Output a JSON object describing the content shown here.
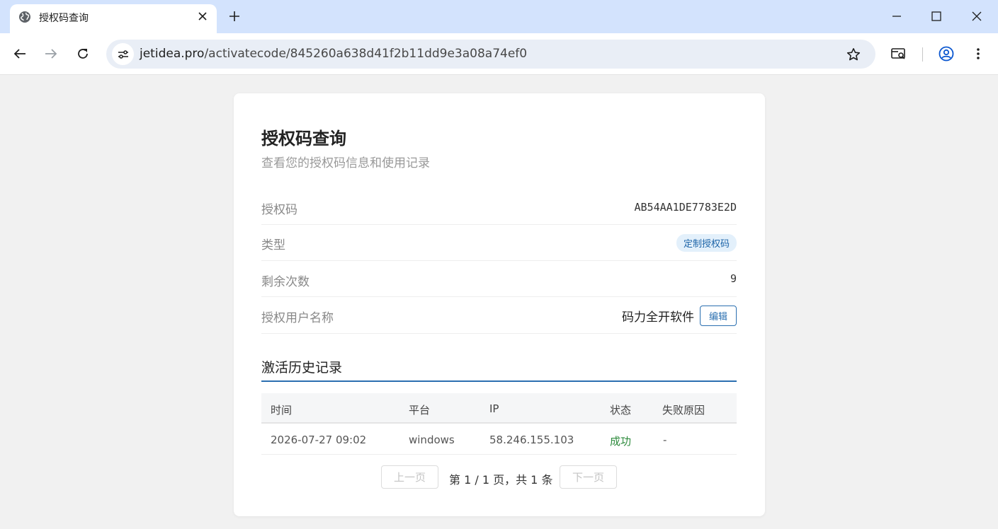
{
  "browser": {
    "tab_title": "授权码查询",
    "url_domain": "jetidea.pro",
    "url_path": "/activatecode/845260a638d41f2b11dd9e3a08a74ef0"
  },
  "page": {
    "title": "授权码查询",
    "subtitle": "查看您的授权码信息和使用记录"
  },
  "info": {
    "code_label": "授权码",
    "code_value": "AB54AA1DE7783E2D",
    "type_label": "类型",
    "type_value": "定制授权码",
    "remaining_label": "剩余次数",
    "remaining_value": "9",
    "user_label": "授权用户名称",
    "user_value": "码力全开软件",
    "edit_label": "编辑"
  },
  "history": {
    "title": "激活历史记录",
    "columns": [
      "时间",
      "平台",
      "IP",
      "状态",
      "失败原因"
    ],
    "rows": [
      [
        "2026-07-27 09:02",
        "windows",
        "58.246.155.103",
        "成功",
        "-"
      ]
    ]
  },
  "pagination": {
    "prev_label": "上一页",
    "info": "第 1 / 1 页，共 1 条",
    "next_label": "下一页"
  },
  "colors": {
    "accent": "#2a6fb0",
    "success": "#2e8b3d",
    "badge_bg": "#e3f0fb"
  }
}
